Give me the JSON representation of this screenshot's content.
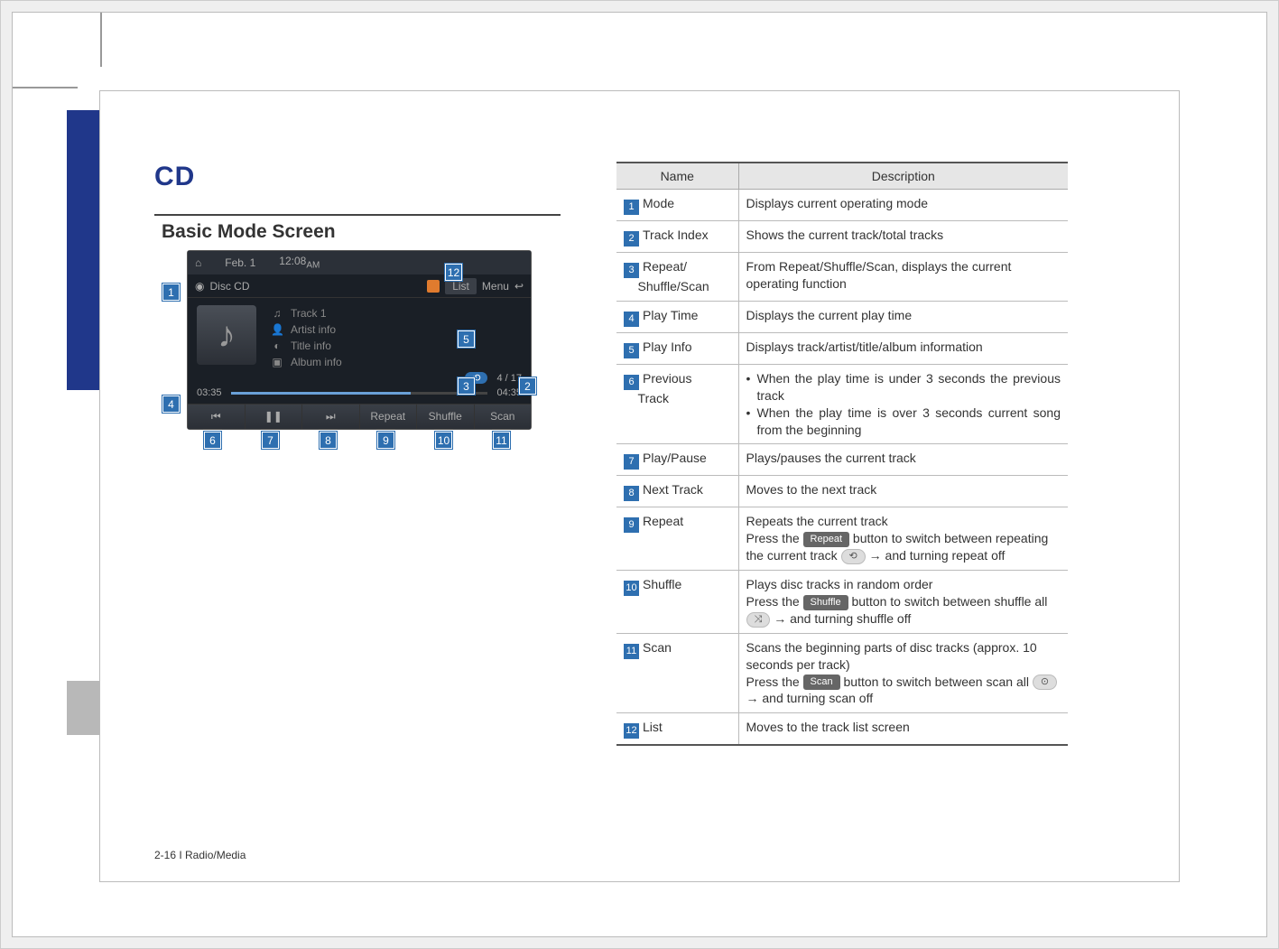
{
  "page": {
    "title_main": "CD",
    "section_title": "Basic Mode Screen",
    "footer": "2-16 I Radio/Media"
  },
  "screenshot": {
    "top_date": "Feb.  1",
    "top_time": "12:08",
    "top_ampm": "AM",
    "mode_label": "Disc CD",
    "list_btn": "List",
    "menu_btn": "Menu",
    "info": {
      "track": "Track 1",
      "artist": "Artist info",
      "title": "Title info",
      "album": "Album info"
    },
    "repeat_indicator": "⟲",
    "track_index": "4 / 17",
    "time_elapsed": "03:35",
    "time_total": "04:35",
    "controls": {
      "prev": "⏮",
      "pause": "❚❚",
      "next": "⏭",
      "repeat": "Repeat",
      "shuffle": "Shuffle",
      "scan": "Scan"
    }
  },
  "callouts": {
    "c1": "1",
    "c2": "2",
    "c3": "3",
    "c4": "4",
    "c5": "5",
    "c6": "6",
    "c7": "7",
    "c8": "8",
    "c9": "9",
    "c10": "10",
    "c11": "11",
    "c12": "12"
  },
  "table": {
    "header_name": "Name",
    "header_desc": "Description",
    "rows": [
      {
        "num": "1",
        "name": "Mode",
        "desc": "Displays current operating mode"
      },
      {
        "num": "2",
        "name": "Track Index",
        "desc": "Shows the current track/total tracks"
      },
      {
        "num": "3",
        "name": "Repeat/\nShuffle/Scan",
        "desc": "From Repeat/Shuffle/Scan, displays the current operating function"
      },
      {
        "num": "4",
        "name": "Play Time",
        "desc": "Displays the current play time"
      },
      {
        "num": "5",
        "name": "Play Info",
        "desc": "Displays track/artist/title/album information"
      },
      {
        "num": "6",
        "name": "Previous\nTrack",
        "desc_list": [
          "When the play time is under 3 seconds the previous track",
          "When the play time is over 3 seconds current song from the beginning"
        ]
      },
      {
        "num": "7",
        "name": "Play/Pause",
        "desc": "Plays/pauses the current track"
      },
      {
        "num": "8",
        "name": "Next Track",
        "desc": "Moves to the next track"
      },
      {
        "num": "9",
        "name": "Repeat",
        "desc_parts": {
          "a": "Repeats the current track",
          "b_pre": "Press the ",
          "b_chip": "Repeat",
          "b_post": " button to switch between repeating the current track ",
          "b_icon": "⟲",
          "b_tail": " → and turning repeat off"
        }
      },
      {
        "num": "10",
        "name": "Shuffle",
        "desc_parts": {
          "a": "Plays disc tracks in random order",
          "b_pre": "Press the ",
          "b_chip": "Shuffle",
          "b_post": " button to switch between shuffle all ",
          "b_icon": "⤨",
          "b_tail": " →  and turning shuffle off"
        }
      },
      {
        "num": "11",
        "name": "Scan",
        "desc_parts": {
          "a": "Scans the beginning parts of disc tracks (approx. 10 seconds per track)",
          "b_pre": "Press the ",
          "b_chip": "Scan",
          "b_post": " button to switch between scan all ",
          "b_icon": "⊙",
          "b_tail": " → and turning scan off"
        }
      },
      {
        "num": "12",
        "name": "List",
        "desc": "Moves to the track list screen"
      }
    ]
  }
}
